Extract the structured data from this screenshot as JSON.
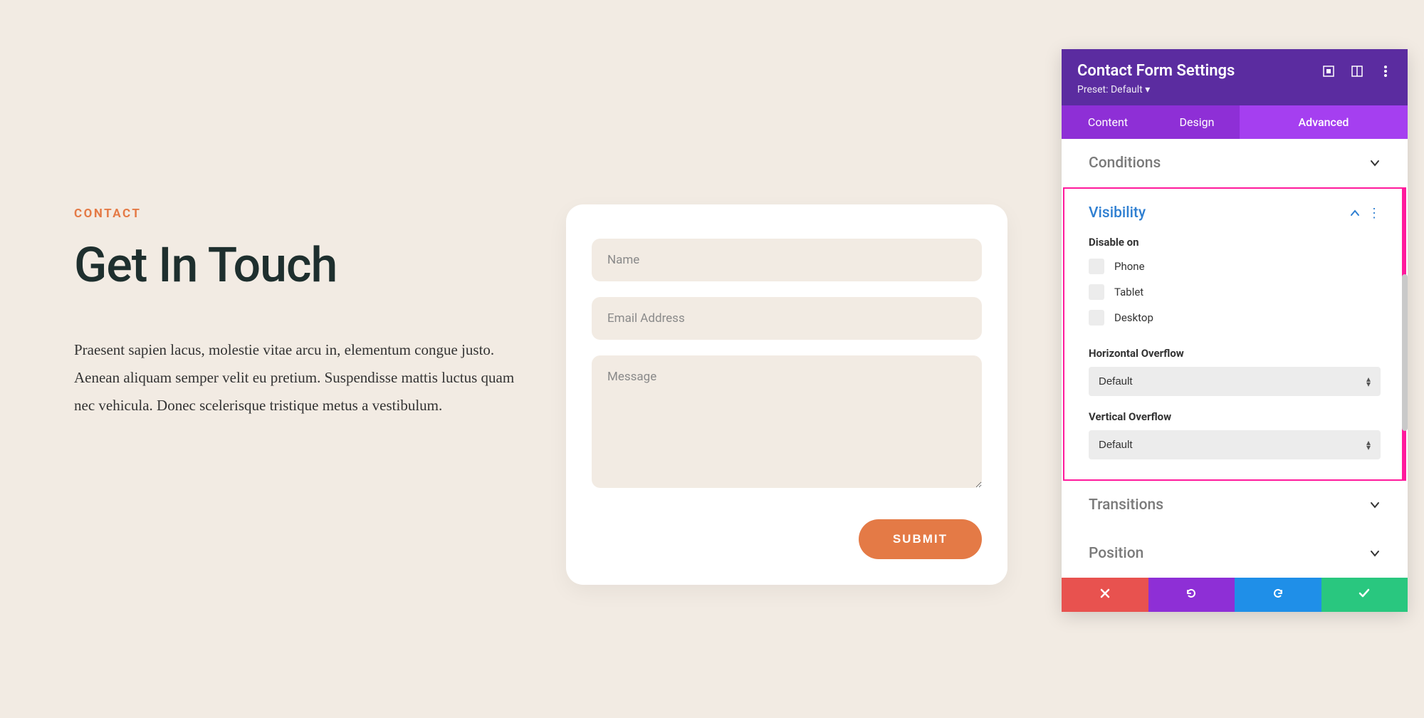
{
  "page": {
    "eyebrow": "CONTACT",
    "headline": "Get In Touch",
    "body": "Praesent sapien lacus, molestie vitae arcu in, elementum congue justo. Aenean aliquam semper velit eu pretium. Suspendisse mattis luctus quam nec vehicula. Donec scelerisque tristique metus a vestibulum."
  },
  "form": {
    "name_placeholder": "Name",
    "email_placeholder": "Email Address",
    "message_placeholder": "Message",
    "submit_label": "SUBMIT"
  },
  "panel": {
    "title": "Contact Form Settings",
    "preset": "Preset: Default ▾",
    "tabs": {
      "content": "Content",
      "design": "Design",
      "advanced": "Advanced"
    },
    "sections": {
      "conditions": "Conditions",
      "visibility": "Visibility",
      "transitions": "Transitions",
      "position": "Position"
    },
    "visibility": {
      "disable_on": "Disable on",
      "phone": "Phone",
      "tablet": "Tablet",
      "desktop": "Desktop",
      "h_overflow_label": "Horizontal Overflow",
      "h_overflow_value": "Default",
      "v_overflow_label": "Vertical Overflow",
      "v_overflow_value": "Default"
    }
  }
}
